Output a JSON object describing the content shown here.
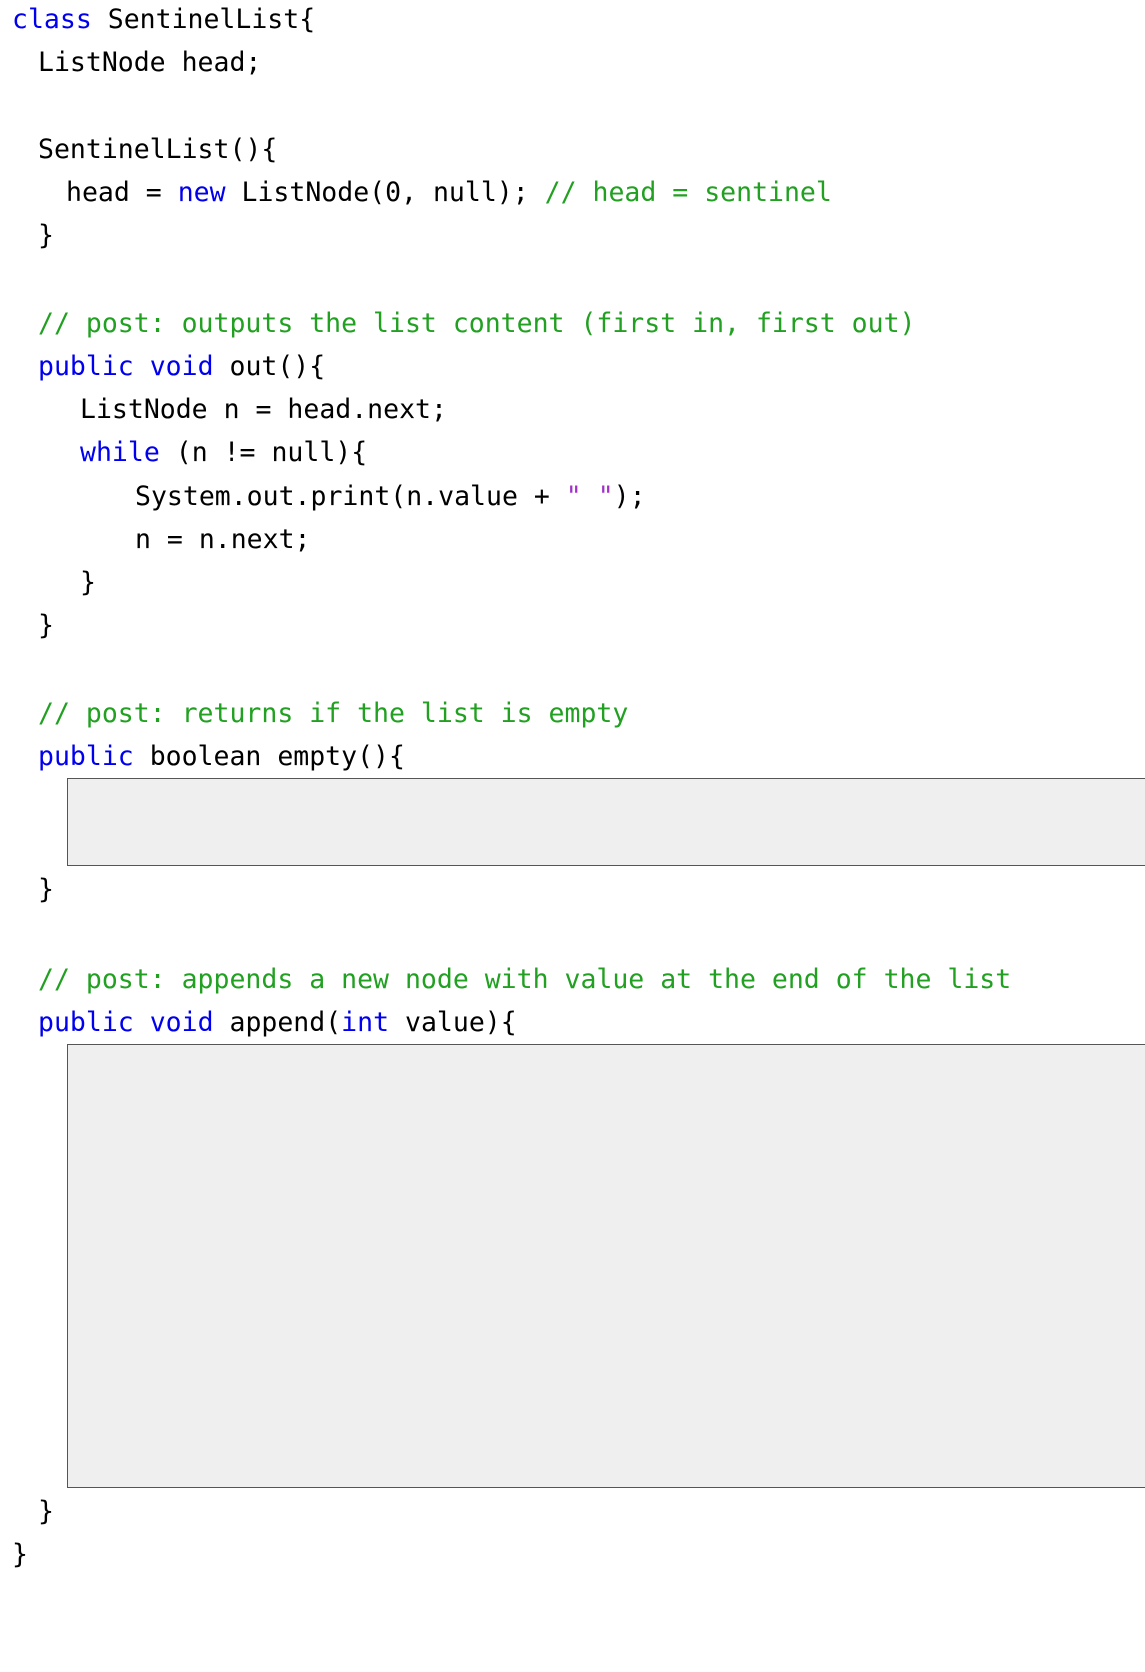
{
  "code": {
    "class_kw": "class",
    "class_name": "SentinelList{",
    "field_decl": "ListNode head;",
    "ctor_sig": "SentinelList(){",
    "ctor_body_pre": "head = ",
    "new_kw": "new",
    "ctor_body_post": " ListNode(0, null); ",
    "ctor_comment": "// head = sentinel",
    "ctor_close": "}",
    "out_comment": "// post: outputs the list content (first in, first out)",
    "public_kw": "public",
    "void_kw": "void",
    "out_sig_rest": " out(){",
    "out_line1": "ListNode n = head.next;",
    "while_kw": "while",
    "while_rest": " (n != null){",
    "print_pre": "System.out.print(n.value + ",
    "print_str": "\" \"",
    "print_post": ");",
    "advance": "n = n.next;",
    "while_close": "}",
    "out_close": "}",
    "empty_comment": "// post: returns if the list is empty",
    "empty_sig_rest": " boolean empty(){",
    "empty_close": "}",
    "append_comment": "// post: appends a new node with value at the end of the list",
    "int_kw": "int",
    "append_sig_mid": " append(",
    "append_sig_rest": " value){",
    "append_close": "}",
    "class_close": "}"
  }
}
